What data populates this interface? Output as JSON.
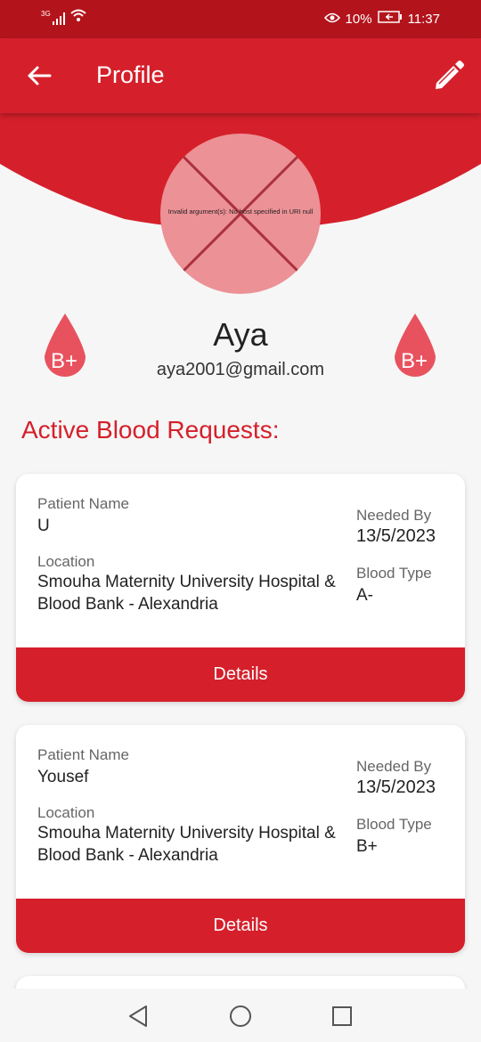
{
  "status_bar": {
    "network": "3G",
    "battery": "10%",
    "time": "11:37"
  },
  "app_bar": {
    "title": "Profile",
    "back_icon": "arrow-left-icon",
    "edit_icon": "pencil-icon"
  },
  "profile": {
    "avatar_error": "Invalid argument(s): No host specified in URI null",
    "name": "Aya",
    "email": "aya2001@gmail.com",
    "blood_badge": "B+"
  },
  "requests_title": "Active Blood Requests:",
  "labels": {
    "patient_name": "Patient Name",
    "location": "Location",
    "needed_by": "Needed By",
    "blood_type": "Blood Type",
    "details": "Details"
  },
  "requests": [
    {
      "patient_name": "U",
      "location": "Smouha Maternity University Hospital & Blood Bank - Alexandria",
      "needed_by": "13/5/2023",
      "blood_type": "A-"
    },
    {
      "patient_name": "Yousef",
      "location": "Smouha Maternity University Hospital & Blood Bank - Alexandria",
      "needed_by": "13/5/2023",
      "blood_type": "B+"
    }
  ],
  "colors": {
    "primary": "#d5202b",
    "status_bar": "#b3141c",
    "drop": "#e8525e"
  }
}
